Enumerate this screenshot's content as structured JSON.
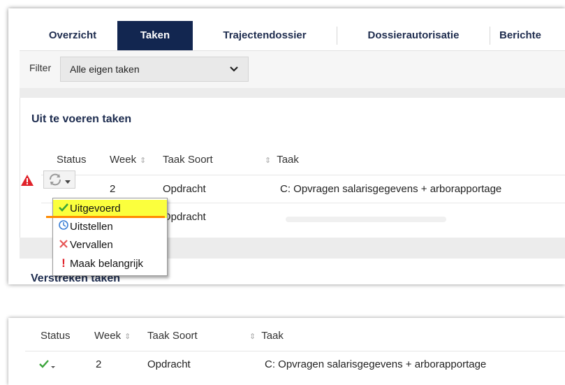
{
  "tabs": [
    "Overzicht",
    "Taken",
    "Trajectendossier",
    "Dossierautorisatie",
    "Berichte"
  ],
  "filter": {
    "label": "Filter",
    "value": "Alle eigen taken"
  },
  "section_title": "Uit te voeren taken",
  "section2_title": "Verstreken taken",
  "columns": {
    "status": "Status",
    "week": "Week",
    "soort": "Taak Soort",
    "taak": "Taak"
  },
  "rows": [
    {
      "week": "2",
      "soort": "Opdracht",
      "taak": "C: Opvragen salarisgegevens + arborapportage"
    },
    {
      "week": "",
      "soort": "Opdracht",
      "taak": ""
    }
  ],
  "status_menu": [
    "Uitgevoerd",
    "Uitstellen",
    "Vervallen",
    "Maak belangrijk"
  ],
  "result": {
    "columns": {
      "status": "Status",
      "week": "Week",
      "soort": "Taak Soort",
      "taak": "Taak"
    },
    "row": {
      "week": "2",
      "soort": "Opdracht",
      "taak": "C: Opvragen salarisgegevens + arborapportage"
    }
  },
  "colors": {
    "nav_active": "#122650",
    "highlight": "#fbff3d",
    "underline": "#ff8a00",
    "check": "#3aa43a",
    "warning": "#e0222a"
  },
  "icons": [
    "warning-icon",
    "refresh-icon",
    "check-icon",
    "clock-icon",
    "cross-icon",
    "exclamation-icon"
  ]
}
